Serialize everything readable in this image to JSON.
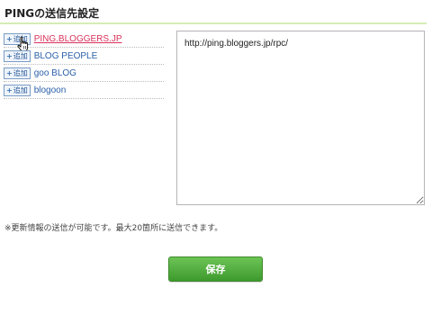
{
  "section": {
    "title": "PINGの送信先設定"
  },
  "ping_services": [
    {
      "add_label": "追加",
      "name": "PING.BLOGGERS.JP",
      "hovered": true
    },
    {
      "add_label": "追加",
      "name": "BLOG PEOPLE",
      "hovered": false
    },
    {
      "add_label": "追加",
      "name": "goo BLOG",
      "hovered": false
    },
    {
      "add_label": "追加",
      "name": "blogoon",
      "hovered": false
    }
  ],
  "ping_urls": {
    "value": "http://ping.bloggers.jp/rpc/"
  },
  "note": "※更新情報の送信が可能です。最大20箇所に送信できます。",
  "save_button": {
    "label": "保存"
  },
  "colors": {
    "accent_green": "#4caf3a",
    "title_rule": "#d6ebb8",
    "link": "#2a5fa8",
    "link_hover": "#d9305a"
  }
}
